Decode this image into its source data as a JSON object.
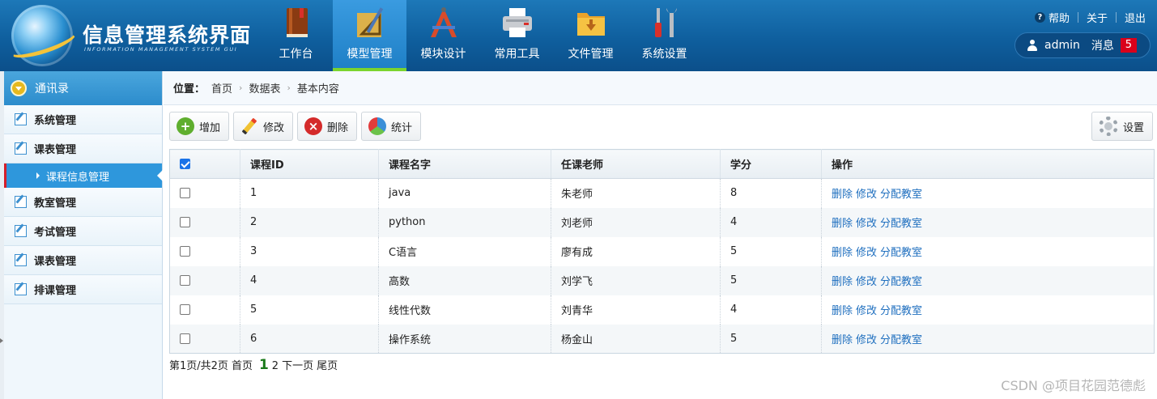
{
  "app": {
    "title": "信息管理系统界面",
    "subtitle": "INFORMATION MANAGEMENT SYSTEM GUI"
  },
  "nav": {
    "items": [
      {
        "label": "工作台",
        "icon": "book-icon"
      },
      {
        "label": "模型管理",
        "icon": "ruler-triangle-icon"
      },
      {
        "label": "模块设计",
        "icon": "design-tools-icon"
      },
      {
        "label": "常用工具",
        "icon": "printer-icon"
      },
      {
        "label": "文件管理",
        "icon": "folder-icon"
      },
      {
        "label": "系统设置",
        "icon": "wrench-screwdriver-icon"
      }
    ],
    "active_index": 1
  },
  "top": {
    "help": "帮助",
    "about": "关于",
    "logout": "退出",
    "username": "admin",
    "messages_label": "消息",
    "messages_count": "5"
  },
  "sidebar": {
    "header": "通讯录",
    "items": [
      {
        "label": "系统管理"
      },
      {
        "label": "课表管理"
      },
      {
        "label": "课程信息管理"
      },
      {
        "label": "教室管理"
      },
      {
        "label": "考试管理"
      },
      {
        "label": "课表管理"
      },
      {
        "label": "排课管理"
      }
    ]
  },
  "breadcrumb": {
    "label": "位置：",
    "items": [
      "首页",
      "数据表",
      "基本内容"
    ]
  },
  "toolbar": {
    "add": "增加",
    "edit": "修改",
    "delete": "删除",
    "stats": "统计",
    "settings": "设置"
  },
  "table": {
    "headers": [
      "课程ID",
      "课程名字",
      "任课老师",
      "学分",
      "操作"
    ],
    "rows": [
      {
        "id": "1",
        "name": "java",
        "teacher": "朱老师",
        "credit": "8"
      },
      {
        "id": "2",
        "name": "python",
        "teacher": "刘老师",
        "credit": "4"
      },
      {
        "id": "3",
        "name": "C语言",
        "teacher": "廖有成",
        "credit": "5"
      },
      {
        "id": "4",
        "name": "高数",
        "teacher": "刘学飞",
        "credit": "5"
      },
      {
        "id": "5",
        "name": "线性代数",
        "teacher": "刘青华",
        "credit": "4"
      },
      {
        "id": "6",
        "name": "操作系统",
        "teacher": "杨金山",
        "credit": "5"
      }
    ],
    "ops": [
      "删除",
      "修改",
      "分配教室"
    ],
    "header_checked": true
  },
  "pager": {
    "info": "第1页/共2页",
    "first": "首页",
    "current": "1",
    "next_page_num": "2",
    "next": "下一页",
    "last": "尾页"
  },
  "watermark": "CSDN @项目花园范德彪"
}
